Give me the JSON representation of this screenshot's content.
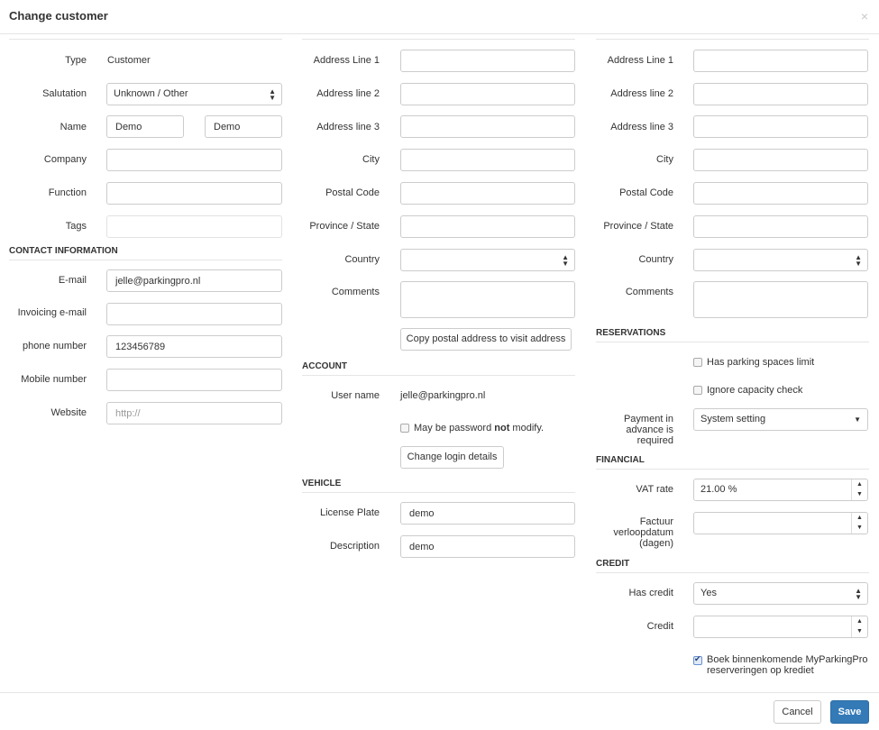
{
  "dialog": {
    "title": "Change customer",
    "close": "×"
  },
  "left": {
    "type_label": "Type",
    "type_value": "Customer",
    "salutation_label": "Salutation",
    "salutation_value": "Unknown / Other",
    "name_label": "Name",
    "first_name": "Demo",
    "last_name": "Demo",
    "company_label": "Company",
    "company_value": "",
    "function_label": "Function",
    "function_value": "",
    "tags_label": "Tags",
    "tags_value": "",
    "contact_section": "CONTACT INFORMATION",
    "email_label": "E-mail",
    "email_value": "jelle@parkingpro.nl",
    "invoicing_label": "Invoicing e-mail",
    "invoicing_value": "",
    "phone_label": "phone number",
    "phone_value": "123456789",
    "mobile_label": "Mobile number",
    "mobile_value": "",
    "website_label": "Website",
    "website_value": "",
    "website_placeholder": "http://"
  },
  "middle": {
    "addr1_label": "Address Line 1",
    "addr1_value": "",
    "addr2_label": "Address line 2",
    "addr2_value": "",
    "addr3_label": "Address line 3",
    "addr3_value": "",
    "city_label": "City",
    "city_value": "",
    "postal_label": "Postal Code",
    "postal_value": "",
    "province_label": "Province / State",
    "province_value": "",
    "country_label": "Country",
    "country_value": "",
    "comments_label": "Comments",
    "comments_value": "",
    "copy_button": "Copy postal address to visit address",
    "account_section": "ACCOUNT",
    "username_label": "User name",
    "username_value": "jelle@parkingpro.nl",
    "pw_text_a": "May be password ",
    "pw_text_b": "not",
    "pw_text_c": " modify.",
    "change_login_button": "Change login details",
    "vehicle_section": "VEHICLE",
    "plate_label": "License Plate",
    "plate_value": "demo",
    "description_label": "Description",
    "description_value": "demo"
  },
  "right": {
    "addr1_label": "Address Line 1",
    "addr1_value": "",
    "addr2_label": "Address line 2",
    "addr2_value": "",
    "addr3_label": "Address line 3",
    "addr3_value": "",
    "city_label": "City",
    "city_value": "",
    "postal_label": "Postal Code",
    "postal_value": "",
    "province_label": "Province / State",
    "province_value": "",
    "country_label": "Country",
    "country_value": "",
    "comments_label": "Comments",
    "comments_value": "",
    "reservations_section": "RESERVATIONS",
    "limit_text": "Has parking spaces limit",
    "capacity_text": "Ignore capacity check",
    "payment_label_1": "Payment in",
    "payment_label_2": "advance is",
    "payment_label_3": "required",
    "payment_value": "System setting",
    "financial_section": "FINANCIAL",
    "vat_label": "VAT rate",
    "vat_value": "21.00 %",
    "factuur_label_1": "Factuur",
    "factuur_label_2": "verloopdatum",
    "factuur_label_3": "(dagen)",
    "factuur_value": "",
    "credit_section": "CREDIT",
    "has_credit_label": "Has credit",
    "has_credit_value": "Yes",
    "credit_label": "Credit",
    "credit_value": "",
    "boek_text_1": "Boek binnenkomende MyParkingPro",
    "boek_text_2": "reserveringen op krediet"
  },
  "footer": {
    "cancel": "Cancel",
    "save": "Save"
  }
}
